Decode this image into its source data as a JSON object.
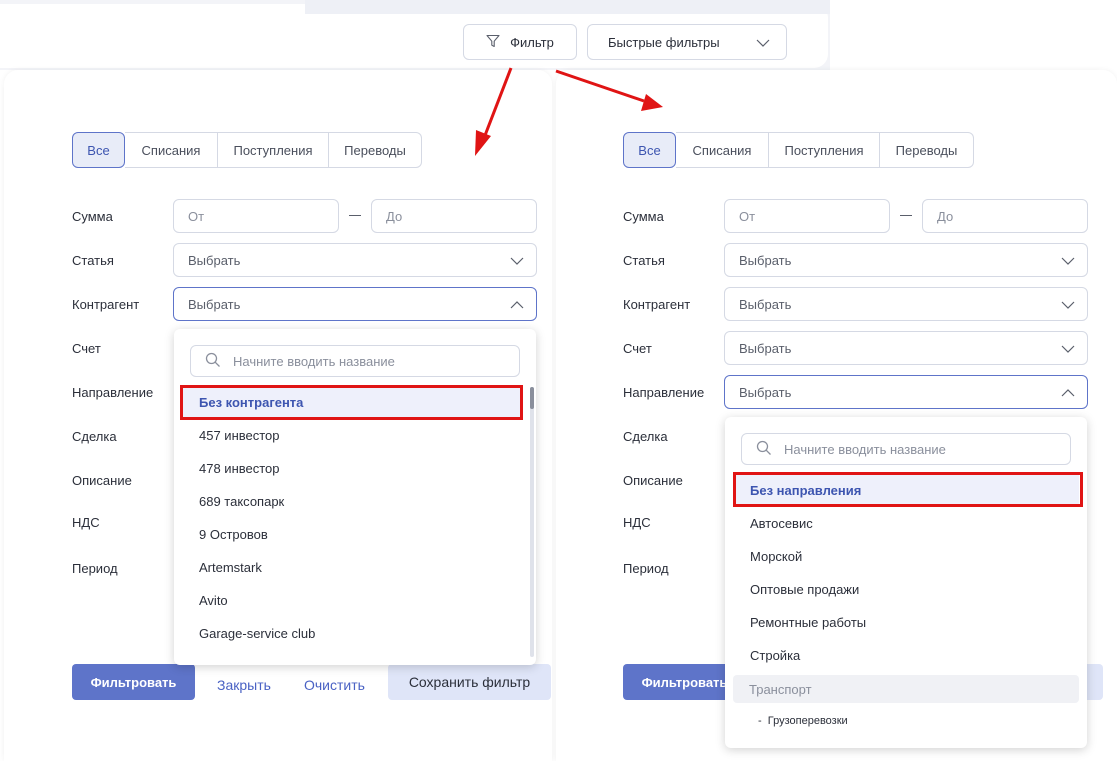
{
  "top_bar": {
    "filter_label": "Фильтр",
    "quick_filters_label": "Быстрые фильтры"
  },
  "tabs": [
    "Все",
    "Списания",
    "Поступления",
    "Переводы"
  ],
  "fields": {
    "amount": "Сумма",
    "article": "Статья",
    "counterparty": "Контрагент",
    "account": "Счет",
    "direction": "Направление",
    "deal": "Сделка",
    "description": "Описание",
    "vat": "НДС",
    "period": "Период"
  },
  "placeholders": {
    "from": "От",
    "to": "До",
    "choose": "Выбрать",
    "search": "Начните вводить название"
  },
  "left_dropdown": {
    "items": [
      "Без контрагента",
      "457 инвестор",
      "478 инвестор",
      "689 таксопарк",
      "9 Островов",
      "Artemstark",
      "Avito",
      "Garage-service club"
    ]
  },
  "right_dropdown": {
    "items": [
      "Без направления",
      "Автосевис",
      "Морской",
      "Оптовые продажи",
      "Ремонтные работы",
      "Стройка"
    ],
    "group": "Транспорт",
    "sub_item": "Грузоперевозки"
  },
  "actions": {
    "filter": "Фильтровать",
    "close": "Закрыть",
    "clear": "Очистить",
    "save": "Сохранить фильтр"
  },
  "colors": {
    "accent": "#5e74c9",
    "highlight_border": "#e01414"
  }
}
